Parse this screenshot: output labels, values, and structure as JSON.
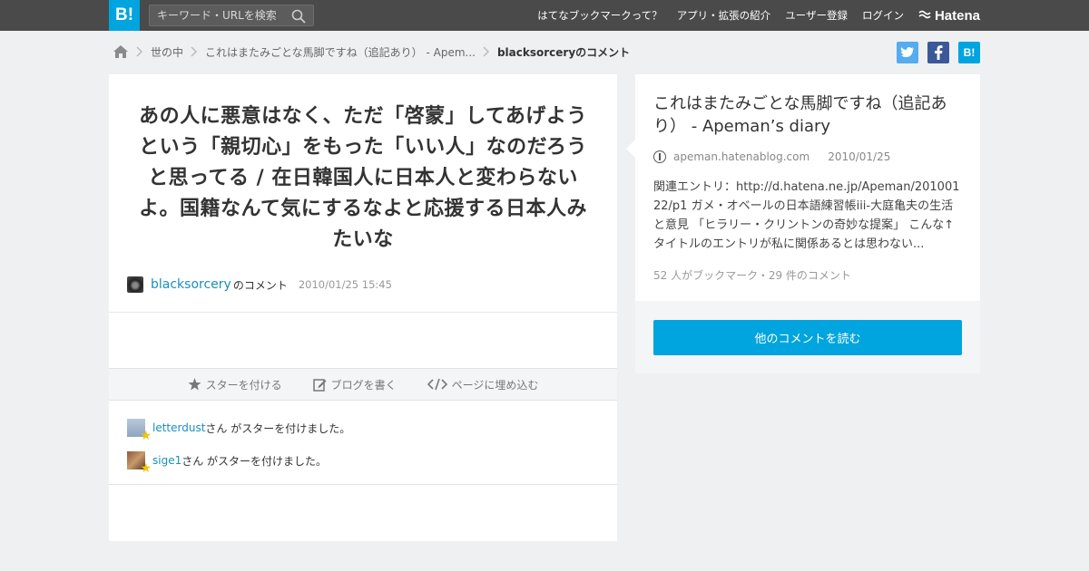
{
  "header": {
    "logo_text": "B!",
    "search_placeholder": "キーワード・URLを検索",
    "nav": [
      {
        "label": "はてなブックマークって？"
      },
      {
        "label": "アプリ・拡張の紹介"
      },
      {
        "label": "ユーザー登録"
      },
      {
        "label": "ログイン"
      }
    ],
    "brand": "Hatena"
  },
  "breadcrumb": {
    "items": [
      "世の中",
      "これはまたみごとな馬脚ですね（追記あり） - Apem..."
    ],
    "current": "blacksorceryのコメント"
  },
  "share": {
    "twitter_icon": "twitter-icon",
    "facebook_icon": "facebook-icon",
    "hatebu_label": "B!"
  },
  "comment": {
    "text": "あの人に悪意はなく、ただ「啓蒙」してあげようという「親切心」をもった「いい人」なのだろうと思ってる / 在日韓国人に日本人と変わらないよ。国籍なんて気にするなよと応援する日本人みたいな",
    "user": "blacksorcery",
    "suffix": "のコメント",
    "date": "2010/01/25 15:45"
  },
  "actions": {
    "star": "スターを付ける",
    "blog": "ブログを書く",
    "embed": "ページに埋め込む"
  },
  "stars": [
    {
      "user": "letterdust",
      "text": "さん がスターを付けました。"
    },
    {
      "user": "sige1",
      "text": "さん がスターを付けました。"
    }
  ],
  "entry": {
    "title": "これはまたみごとな馬脚ですね（追記あり） - Apeman’s diary",
    "domain": "apeman.hatenablog.com",
    "date": "2010/01/25",
    "summary": "関連エントリ：http://d.hatena.ne.jp/Apeman/20100122/p1 ガメ・オベールの日本語練習帳iii-大庭亀夫の生活と意見 「ヒラリー・クリントンの奇妙な提案」 こんな↑タイトルのエントリが私に関係あるとは思わない...",
    "count": "52 人がブックマーク・29 件のコメント",
    "more_button": "他のコメントを読む"
  },
  "colors": {
    "accent": "#00a4de",
    "header_bg": "#4a4a4a",
    "link": "#1b8fbe",
    "star": "#f5c400"
  }
}
